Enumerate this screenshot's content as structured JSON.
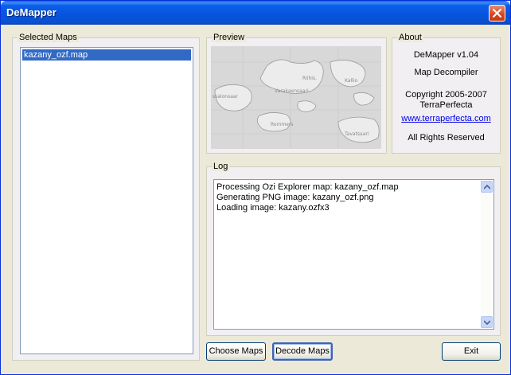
{
  "window": {
    "title": "DeMapper"
  },
  "selected_maps": {
    "legend": "Selected Maps",
    "items": [
      {
        "label": "kazany_ozf.map",
        "selected": true
      }
    ]
  },
  "preview": {
    "legend": "Preview",
    "map_labels": [
      "Riihis.",
      "Kallio",
      "Varakaensaari",
      "Rommers",
      "Tavatsaari",
      "ssalonsaar"
    ]
  },
  "about": {
    "legend": "About",
    "app_version": "DeMapper v1.04",
    "subtitle": "Map Decompiler",
    "copyright": "Copyright 2005-2007",
    "company": "TerraPerfecta",
    "link": "www.terraperfecta.com",
    "rights": "All Rights Reserved"
  },
  "log": {
    "legend": "Log",
    "lines": [
      "Processing Ozi Explorer map: kazany_ozf.map",
      "Generating PNG image: kazany_ozf.png",
      "Loading image: kazany.ozfx3"
    ]
  },
  "buttons": {
    "choose": "Choose Maps",
    "decode": "Decode Maps",
    "exit": "Exit"
  },
  "colors": {
    "title_bar": "#0653de",
    "selection": "#316ac5",
    "link": "#0000ee"
  }
}
